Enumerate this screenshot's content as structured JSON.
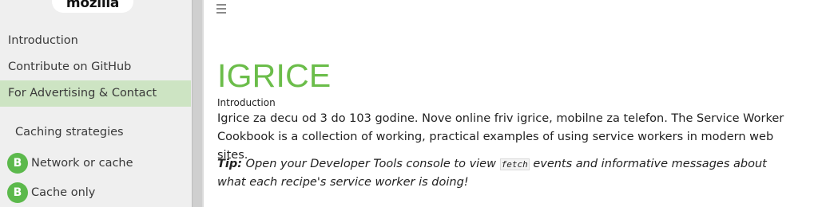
{
  "sidebar": {
    "logo": "mozilla",
    "nav": [
      {
        "label": "Introduction"
      },
      {
        "label": "Contribute on GitHub"
      },
      {
        "label": "For Advertising & Contact"
      }
    ],
    "section_title": "Caching strategies",
    "recipes": [
      {
        "badge": "B",
        "label": "Network or cache"
      },
      {
        "badge": "B",
        "label": "Cache only"
      }
    ]
  },
  "content": {
    "menu_icon": "hamburger-icon",
    "title": "IGRICE",
    "subtitle": "Introduction",
    "paragraph": "Igrice za decu od 3 do 103 godine. Nove online friv igrice, mobilne za telefon. The Service Worker Cookbook is a collection of working, practical examples of using service workers in modern web sites.",
    "tip": {
      "label": "Tip:",
      "before": "Open your Developer Tools console to view",
      "code": "fetch",
      "after": "events and informative messages about what each recipe's service worker is doing!"
    }
  },
  "colors": {
    "accent_green": "#6bbd4a",
    "badge_green": "#5cb94c",
    "active_nav_bg": "#cde4c3",
    "sidebar_bg": "#efefef"
  }
}
